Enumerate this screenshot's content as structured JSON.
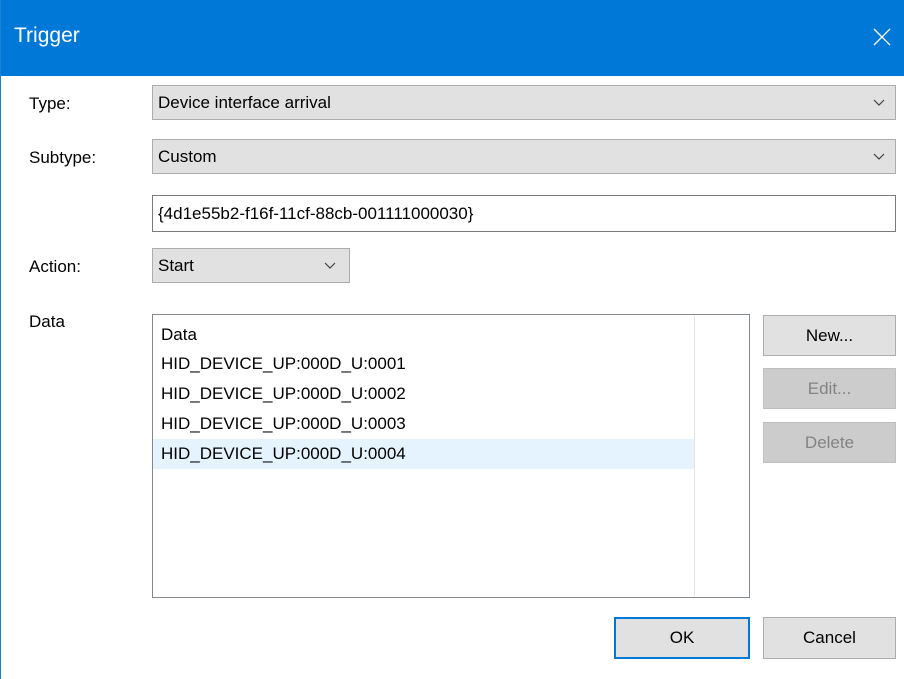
{
  "window": {
    "title": "Trigger"
  },
  "form": {
    "type_label": "Type:",
    "type_value": "Device interface arrival",
    "subtype_label": "Subtype:",
    "subtype_value": "Custom",
    "guid_value": "{4d1e55b2-f16f-11cf-88cb-001111000030}",
    "action_label": "Action:",
    "action_value": "Start",
    "data_label": "Data"
  },
  "data_list": {
    "header": "Data",
    "rows": [
      "HID_DEVICE_UP:000D_U:0001",
      "HID_DEVICE_UP:000D_U:0002",
      "HID_DEVICE_UP:000D_U:0003",
      "HID_DEVICE_UP:000D_U:0004"
    ],
    "selected_index": 3
  },
  "buttons": {
    "new": "New...",
    "edit": "Edit...",
    "delete": "Delete",
    "ok": "OK",
    "cancel": "Cancel"
  },
  "colors": {
    "titlebar": "#0078d7",
    "selection": "#e5f3ff",
    "button_face": "#e1e1e1"
  },
  "icons": {
    "close": "close-icon",
    "dropdown": "chevron-down-icon"
  }
}
